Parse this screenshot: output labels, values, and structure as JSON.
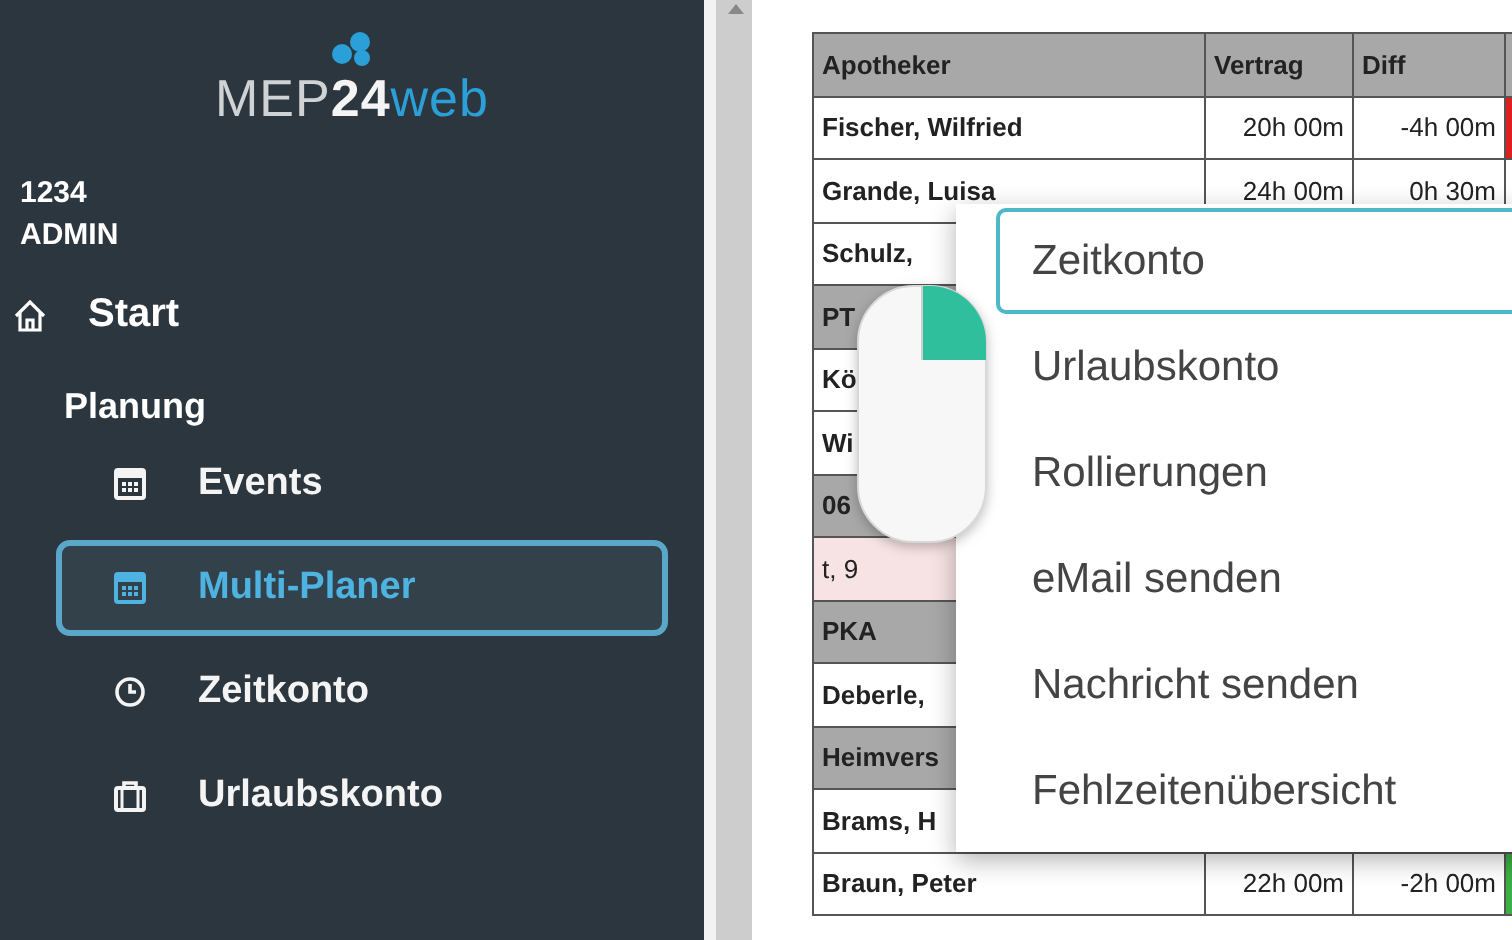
{
  "sidebar": {
    "logo": [
      {
        "text": "MEP",
        "kind": "plain"
      },
      {
        "text": "24",
        "kind": "bold"
      },
      {
        "text": "web",
        "kind": "accent"
      }
    ],
    "user": {
      "id": "1234",
      "role": "ADMIN"
    },
    "start": {
      "label": "Start"
    },
    "section": "Planung",
    "items": [
      {
        "label": "Events",
        "selected": false
      },
      {
        "label": "Multi-Planer",
        "selected": true
      },
      {
        "label": "Zeitkonto",
        "selected": false
      },
      {
        "label": "Urlaubskonto",
        "selected": false
      }
    ]
  },
  "table": {
    "columns": [
      "Apotheker",
      "Vertrag",
      "Diff"
    ],
    "rows": [
      {
        "kind": "person",
        "cells": [
          "Fischer, Wilfried",
          "20h 00m",
          "-4h 00m"
        ],
        "color": "#e02020"
      },
      {
        "kind": "person",
        "cells": [
          "Grande, Luisa",
          "24h 00m",
          "0h 30m"
        ]
      },
      {
        "kind": "person",
        "cells": [
          "Schulz,"
        ]
      },
      {
        "kind": "group",
        "cells": [
          "PT"
        ]
      },
      {
        "kind": "person",
        "cells": [
          "Kö"
        ]
      },
      {
        "kind": "person",
        "cells": [
          "Wi"
        ]
      },
      {
        "kind": "group",
        "cells": [
          "06"
        ]
      },
      {
        "kind": "absence",
        "cells": [
          "t, 9"
        ]
      },
      {
        "kind": "group",
        "cells": [
          "PKA"
        ]
      },
      {
        "kind": "person",
        "cells": [
          "Deberle,"
        ]
      },
      {
        "kind": "group",
        "cells": [
          "Heimvers"
        ]
      },
      {
        "kind": "person",
        "cells": [
          "Brams, H"
        ]
      },
      {
        "kind": "person",
        "cells": [
          "Braun, Peter",
          "22h 00m",
          "-2h 00m"
        ],
        "color": "#3cb043"
      }
    ]
  },
  "context_menu": {
    "items": [
      {
        "label": "Zeitkonto",
        "selected": true
      },
      {
        "label": "Urlaubskonto",
        "selected": false
      },
      {
        "label": "Rollierungen",
        "selected": false
      },
      {
        "label": "eMail senden",
        "selected": false
      },
      {
        "label": "Nachricht senden",
        "selected": false
      },
      {
        "label": "Fehlzeitenübersicht",
        "selected": false
      }
    ]
  }
}
